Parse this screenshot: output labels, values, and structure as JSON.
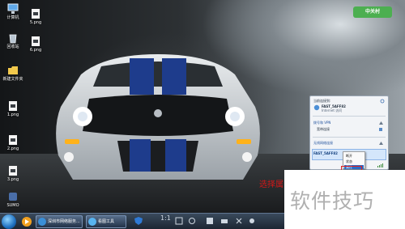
{
  "desktop": {
    "icons": [
      {
        "label": "计算机",
        "icon": "computer-icon"
      },
      {
        "label": "回收站",
        "icon": "recycle-bin-icon"
      },
      {
        "label": "新建文件夹",
        "icon": "folder-icon"
      },
      {
        "label": "1.png",
        "icon": "image-file-icon"
      },
      {
        "label": "2.png",
        "icon": "image-file-icon"
      },
      {
        "label": "3.png",
        "icon": "image-file-icon"
      },
      {
        "label": "5.png",
        "icon": "image-file-icon"
      },
      {
        "label": "6.png",
        "icon": "image-file-icon"
      },
      {
        "label": "SUMO",
        "icon": "app-icon"
      }
    ],
    "watermark_logo": "中关村"
  },
  "network_popup": {
    "header": "当前连接到:",
    "current_network": "FAST_5AFF82",
    "current_status": "Internet 访问",
    "dialup_label": "拨号和 VPN",
    "wired_label": "宽带连接",
    "wireless_label": "无线网络连接",
    "selected_network": "FAST_5AFF82",
    "colors": {
      "accent": "#2d6bc4",
      "selection": "#d4e6fb"
    }
  },
  "context_menu": {
    "items": [
      "断开",
      "状态",
      "属性"
    ],
    "highlighted_index": 2
  },
  "annotation": {
    "text": "选择属",
    "color": "#d01818"
  },
  "watermark": "软件技巧",
  "taskbar": {
    "apps": [
      {
        "label": "深圳市网络服务...",
        "icon": "browser-icon"
      },
      {
        "label": "看图工具",
        "icon": "image-viewer-icon"
      }
    ],
    "zoom_label": "1:1"
  }
}
